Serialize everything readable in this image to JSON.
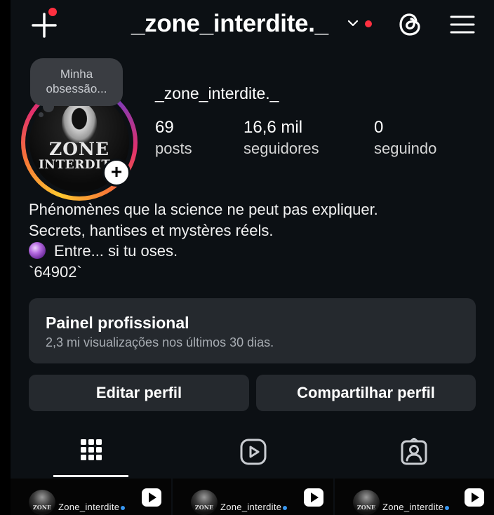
{
  "topbar": {
    "username": "_zone_interdite._",
    "create_icon": "plus-icon",
    "switch_icon": "chevron-down-icon",
    "threads_icon": "threads-icon",
    "menu_icon": "hamburger-menu-icon"
  },
  "note": {
    "text": "Minha obsessão..."
  },
  "avatar": {
    "line1": "ZONE",
    "line2": "INTERDITE",
    "add_icon": "+"
  },
  "profile": {
    "name": "_zone_interdite._",
    "stats": [
      {
        "value": "69",
        "label": "posts"
      },
      {
        "value": "16,6 mil",
        "label": "seguidores"
      },
      {
        "value": "0",
        "label": "seguindo"
      }
    ]
  },
  "bio": {
    "line1": "Phénomènes que la science ne peut pas expliquer.",
    "line2": "Secrets, hantises et mystères réels.",
    "line3": "Entre... si tu oses.",
    "line4": "`64902`",
    "emoji_icon": "crystal-ball-icon"
  },
  "dashboard": {
    "title": "Painel profissional",
    "subtitle": "2,3 mi visualizações nos últimos 30 dias."
  },
  "buttons": {
    "edit": "Editar perfil",
    "share": "Compartilhar perfil"
  },
  "tabs": [
    {
      "icon": "grid-icon",
      "active": true
    },
    {
      "icon": "reels-icon",
      "active": false
    },
    {
      "icon": "tagged-icon",
      "active": false
    }
  ],
  "thumbnails": [
    {
      "logo_text": "ZONE",
      "account": "Zone_interdite"
    },
    {
      "logo_text": "ZONE",
      "account": "Zone_interdite"
    },
    {
      "logo_text": "ZONE",
      "account": "Zone_interdite"
    }
  ],
  "colors": {
    "background": "#0c1014",
    "card": "#25292e",
    "notification_red": "#ff3040",
    "verified_blue": "#3897f0"
  }
}
